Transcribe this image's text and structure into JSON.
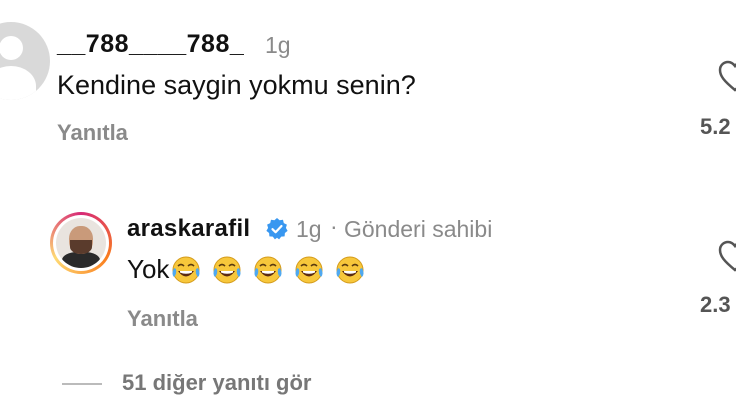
{
  "comment1": {
    "username": "__788____788_",
    "time": "1g",
    "text": "Kendine saygin yokmu senin?",
    "reply_label": "Yanıtla",
    "likes": "5.2"
  },
  "comment2": {
    "username": "araskarafil",
    "time": "1g",
    "separator": "·",
    "author_label": "Gönderi sahibi",
    "text": "Yok",
    "emojis": [
      "crying-laughing-icon",
      "crying-laughing-icon",
      "crying-laughing-icon",
      "crying-laughing-icon",
      "crying-laughing-icon"
    ],
    "reply_label": "Yanıtla",
    "likes": "2.3"
  },
  "view_replies": {
    "label": "51 diğer yanıtı gör"
  },
  "colors": {
    "verified": "#3897f0",
    "secondary_text": "#8a8a8a",
    "emoji_face": "#f7c73b"
  }
}
